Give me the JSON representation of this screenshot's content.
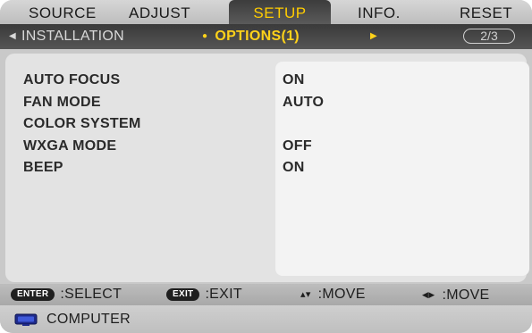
{
  "tabs": [
    {
      "label": "SOURCE",
      "active": false
    },
    {
      "label": "ADJUST",
      "active": false
    },
    {
      "label": "SETUP",
      "active": true
    },
    {
      "label": "INFO.",
      "active": false
    },
    {
      "label": "RESET",
      "active": false
    }
  ],
  "subtabs": {
    "prev": {
      "label": "INSTALLATION",
      "icon": "arrow-left-icon"
    },
    "current": {
      "label": "OPTIONS(1)",
      "icon": "bullet-icon"
    },
    "next": {
      "icon": "arrow-right-icon"
    },
    "page_indicator": "2/3"
  },
  "settings": [
    {
      "label": "AUTO FOCUS",
      "value": "ON"
    },
    {
      "label": "FAN MODE",
      "value": "AUTO"
    },
    {
      "label": "COLOR SYSTEM",
      "value": ""
    },
    {
      "label": "WXGA MODE",
      "value": "OFF"
    },
    {
      "label": "BEEP",
      "value": "ON"
    }
  ],
  "footer": {
    "enter_key": "ENTER",
    "enter_action": ":SELECT",
    "exit_key": "EXIT",
    "exit_action": ":EXIT",
    "updown_icon": "up-down-arrows-icon",
    "updown_action": ":MOVE",
    "leftright_icon": "left-right-arrows-icon",
    "leftright_action": ":MOVE"
  },
  "status": {
    "icon": "computer-monitor-icon",
    "source": "COMPUTER"
  },
  "colors": {
    "active_tab_text": "#ffcc00",
    "active_subtab_text": "#ffd21a",
    "tab_active_bg": "#4a4a4a"
  }
}
